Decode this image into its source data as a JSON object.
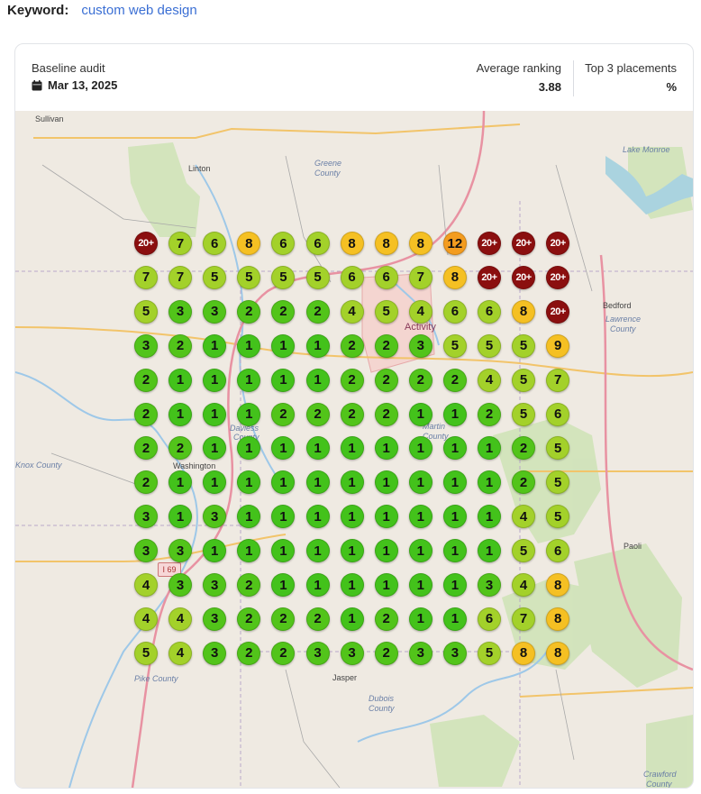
{
  "keyword": {
    "label": "Keyword:",
    "value": "custom web design"
  },
  "card": {
    "baseline_title": "Baseline audit",
    "baseline_date": "Mar 13, 2025",
    "avg_label": "Average ranking",
    "avg_value": "3.88",
    "top3_label": "Top 3 placements",
    "top3_value": "%"
  },
  "map_labels": {
    "sullivan": "Sullivan",
    "linton": "Linton",
    "greene": "Greene",
    "greene_county": "County",
    "lake_monroe": "Lake Monroe",
    "bedford": "Bedford",
    "lawrence": "Lawrence",
    "lawrence_county": "County",
    "knox": "Knox County",
    "washington": "Washington",
    "daviess": "Daviess",
    "daviess_county": "County",
    "martin": "Martin",
    "martin_county": "County",
    "paoli": "Paoli",
    "activity": "Activity",
    "pike": "Pike County",
    "jasper": "Jasper",
    "dubois": "Dubois",
    "dubois_county": "County",
    "crawford": "Crawford",
    "crawford_county": "County",
    "i69": "I 69"
  },
  "colors": {
    "rank_1": "#43c21b",
    "rank_2_3": "#52c41a",
    "rank_4_7": "#a3d12a",
    "rank_8_10": "#f5c023",
    "rank_11_19": "#f39c1f",
    "rank_20_plus": "#8b0f0f",
    "link": "#3b6fd4"
  },
  "grid": {
    "rows": [
      [
        "20+",
        "7",
        "6",
        "8",
        "6",
        "6",
        "8",
        "8",
        "8",
        "12",
        "20+",
        "20+",
        "20+"
      ],
      [
        "7",
        "7",
        "5",
        "5",
        "5",
        "5",
        "6",
        "6",
        "7",
        "8",
        "20+",
        "20+",
        "20+"
      ],
      [
        "5",
        "3",
        "3",
        "2",
        "2",
        "2",
        "4",
        "5",
        "4",
        "6",
        "6",
        "8",
        "20+"
      ],
      [
        "3",
        "2",
        "1",
        "1",
        "1",
        "1",
        "2",
        "2",
        "3",
        "5",
        "5",
        "5",
        "9"
      ],
      [
        "2",
        "1",
        "1",
        "1",
        "1",
        "1",
        "2",
        "2",
        "2",
        "2",
        "4",
        "5",
        "7"
      ],
      [
        "2",
        "1",
        "1",
        "1",
        "2",
        "2",
        "2",
        "2",
        "1",
        "1",
        "2",
        "5",
        "6"
      ],
      [
        "2",
        "2",
        "1",
        "1",
        "1",
        "1",
        "1",
        "1",
        "1",
        "1",
        "1",
        "2",
        "5"
      ],
      [
        "2",
        "1",
        "1",
        "1",
        "1",
        "1",
        "1",
        "1",
        "1",
        "1",
        "1",
        "2",
        "5"
      ],
      [
        "3",
        "1",
        "3",
        "1",
        "1",
        "1",
        "1",
        "1",
        "1",
        "1",
        "1",
        "4",
        "5"
      ],
      [
        "3",
        "3",
        "1",
        "1",
        "1",
        "1",
        "1",
        "1",
        "1",
        "1",
        "1",
        "5",
        "6"
      ],
      [
        "4",
        "3",
        "3",
        "2",
        "1",
        "1",
        "1",
        "1",
        "1",
        "1",
        "3",
        "4",
        "8"
      ],
      [
        "4",
        "4",
        "3",
        "2",
        "2",
        "2",
        "1",
        "2",
        "1",
        "1",
        "6",
        "7",
        "8"
      ],
      [
        "5",
        "4",
        "3",
        "2",
        "2",
        "3",
        "3",
        "2",
        "3",
        "3",
        "5",
        "8",
        "8"
      ]
    ]
  }
}
